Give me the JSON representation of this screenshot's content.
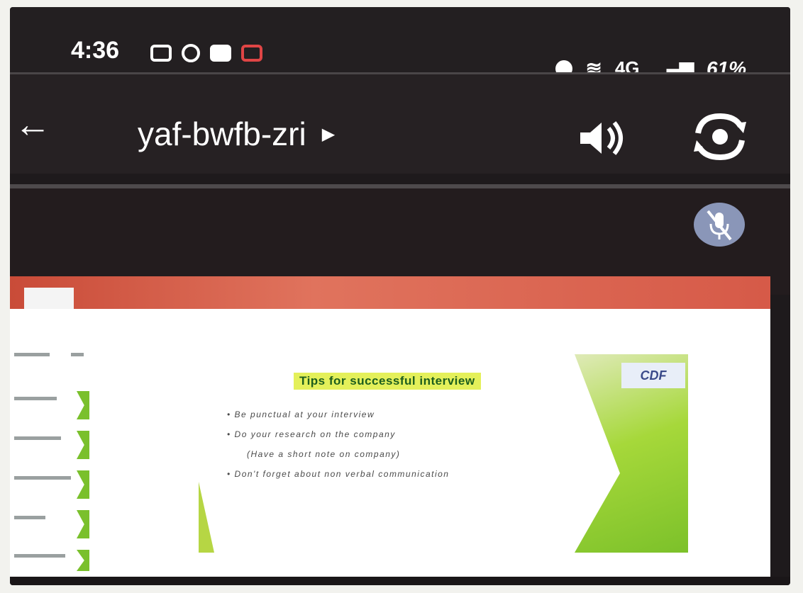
{
  "status_bar": {
    "time": "4:36",
    "network_label": "4G",
    "battery": "61%"
  },
  "app_bar": {
    "meeting_code": "yaf-bwfb-zri"
  },
  "slide": {
    "logo": "CDF",
    "title": "Tips for successful interview",
    "bullets": [
      "• Be punctual at your interview",
      "• Do your research on the company",
      "(Have a short note on company)",
      "• Don't forget about non verbal communication"
    ]
  },
  "colors": {
    "accent_red": "#d65a48",
    "slide_green": "#7ac02c",
    "title_highlight": "#e4f05a"
  }
}
